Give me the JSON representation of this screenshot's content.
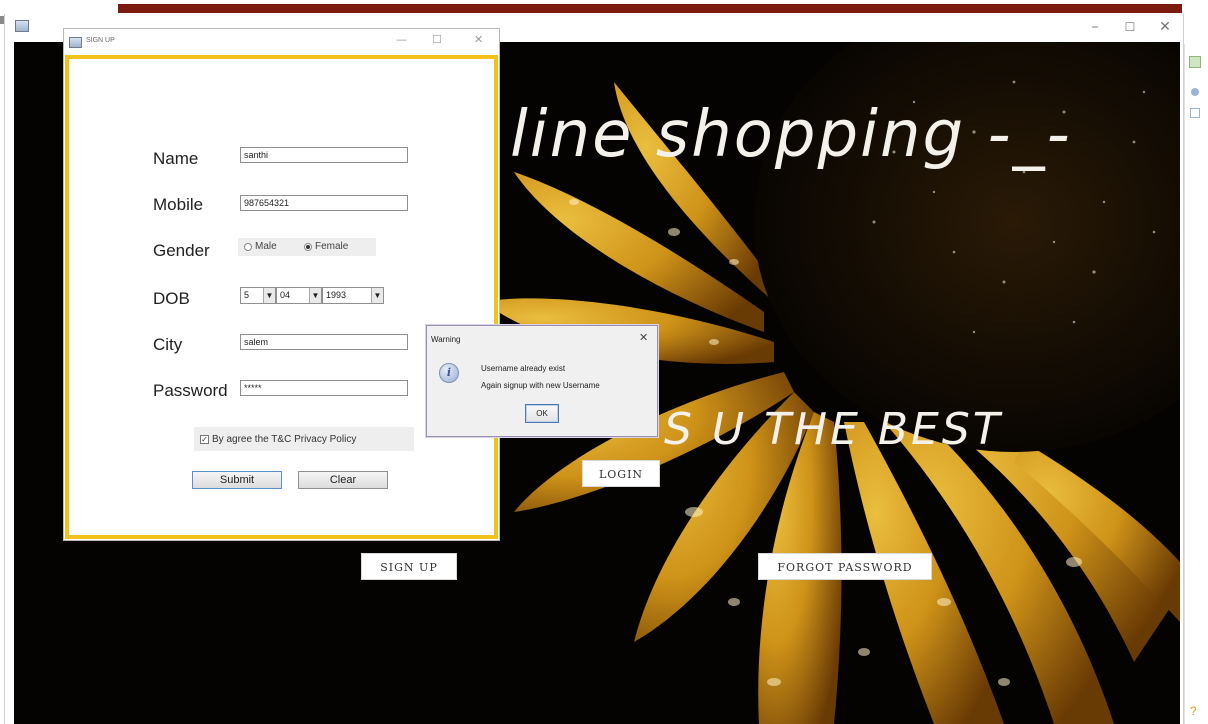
{
  "colors": {
    "accent_border": "#f3c11b",
    "doc_rule": "#7b1b10",
    "background": "#050301",
    "petal": "#e0a41c"
  },
  "main_window": {
    "controls": {
      "minimize": "–",
      "maximize": "☐",
      "close": "✕"
    }
  },
  "background": {
    "title": "line shopping -_-",
    "tagline": "S U THE BEST",
    "buttons": {
      "login": "LOGIN",
      "signup": "SIGN UP",
      "forgot": "FORGOT PASSWORD"
    }
  },
  "signup_dialog": {
    "title": "SIGN UP",
    "controls": {
      "minimize": "—",
      "maximize": "☐",
      "close": "✕"
    },
    "fields": {
      "name": {
        "label": "Name",
        "value": "santhi"
      },
      "mobile": {
        "label": "Mobile",
        "value": "987654321"
      },
      "gender": {
        "label": "Gender",
        "options": [
          "Male",
          "Female"
        ],
        "selected": "Female"
      },
      "dob": {
        "label": "DOB",
        "day": "5",
        "month": "04",
        "year": "1993"
      },
      "city": {
        "label": "City",
        "value": "salem"
      },
      "password": {
        "label": "Password",
        "value": "*****"
      }
    },
    "agree_text": "By agree the T&C Privacy Policy",
    "agree_checked": true,
    "submit_label": "Submit",
    "clear_label": "Clear"
  },
  "warning_dialog": {
    "title": "Warning",
    "close": "✕",
    "icon": "info-icon",
    "icon_glyph": "i",
    "line1": "Username already exist",
    "line2": "Again signup  with new Username",
    "ok_label": "OK"
  }
}
